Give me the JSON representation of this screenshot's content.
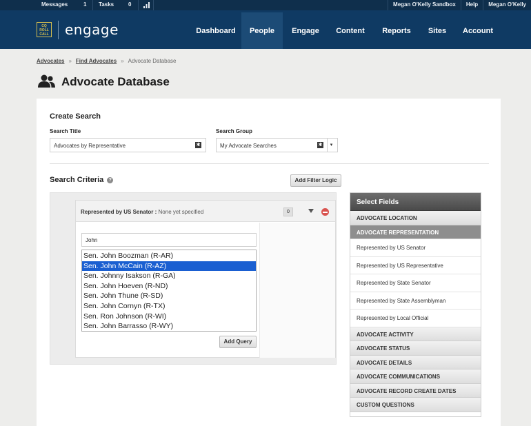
{
  "utility_bar": {
    "messages_label": "Messages",
    "messages_count": "1",
    "tasks_label": "Tasks",
    "tasks_count": "0",
    "account_name": "Megan O'Kelly Sandbox",
    "help": "Help",
    "user": "Megan O'Kelly"
  },
  "header": {
    "logo_mark": "CQ ROLL CALL",
    "logo_text": "engage",
    "nav": [
      "Dashboard",
      "People",
      "Engage",
      "Content",
      "Reports",
      "Sites",
      "Account"
    ],
    "active_nav": "People"
  },
  "breadcrumb": {
    "items": [
      "Advocates",
      "Find Advocates"
    ],
    "current": "Advocate Database",
    "separator": "»"
  },
  "page_title": "Advocate Database",
  "create_search": {
    "heading": "Create Search",
    "title_label": "Search Title",
    "title_value": "Advocates by Representative",
    "group_label": "Search Group",
    "group_value": "My Advocate Searches"
  },
  "criteria": {
    "heading": "Search Criteria",
    "add_filter_logic": "Add Filter Logic",
    "filter": {
      "name": "Represented by US Senator",
      "colon": ":",
      "value": "None yet specified",
      "count": "0",
      "search_text": "John",
      "options": [
        "Sen. John Boozman (R-AR)",
        "Sen. John McCain (R-AZ)",
        "Sen. Johnny Isakson (R-GA)",
        "Sen. John Hoeven (R-ND)",
        "Sen. John Thune (R-SD)",
        "Sen. John Cornyn (R-TX)",
        "Sen. Ron Johnson (R-WI)",
        "Sen. John Barrasso (R-WY)"
      ],
      "selected_index": 1,
      "add_query": "Add Query"
    }
  },
  "select_fields": {
    "heading": "Select Fields",
    "sections": [
      {
        "label": "ADVOCATE LOCATION"
      },
      {
        "label": "ADVOCATE REPRESENTATION",
        "items": [
          "Represented by US Senator",
          "Represented by US Representative",
          "Represented by State Senator",
          "Represented by State Assemblyman",
          "Represented by Local Official"
        ]
      },
      {
        "label": "ADVOCATE ACTIVITY"
      },
      {
        "label": "ADVOCATE STATUS"
      },
      {
        "label": "ADVOCATE DETAILS"
      },
      {
        "label": "ADVOCATE COMMUNICATIONS"
      },
      {
        "label": "ADVOCATE RECORD CREATE DATES"
      },
      {
        "label": "CUSTOM QUESTIONS"
      }
    ]
  },
  "colors": {
    "utility_bg": "#0f2f4c",
    "header_bg": "#0f3a63",
    "nav_active_bg": "#1c4b76",
    "logo_accent": "#d8c04e",
    "selected_option": "#1a5fd1",
    "remove_red": "#d9534f"
  }
}
